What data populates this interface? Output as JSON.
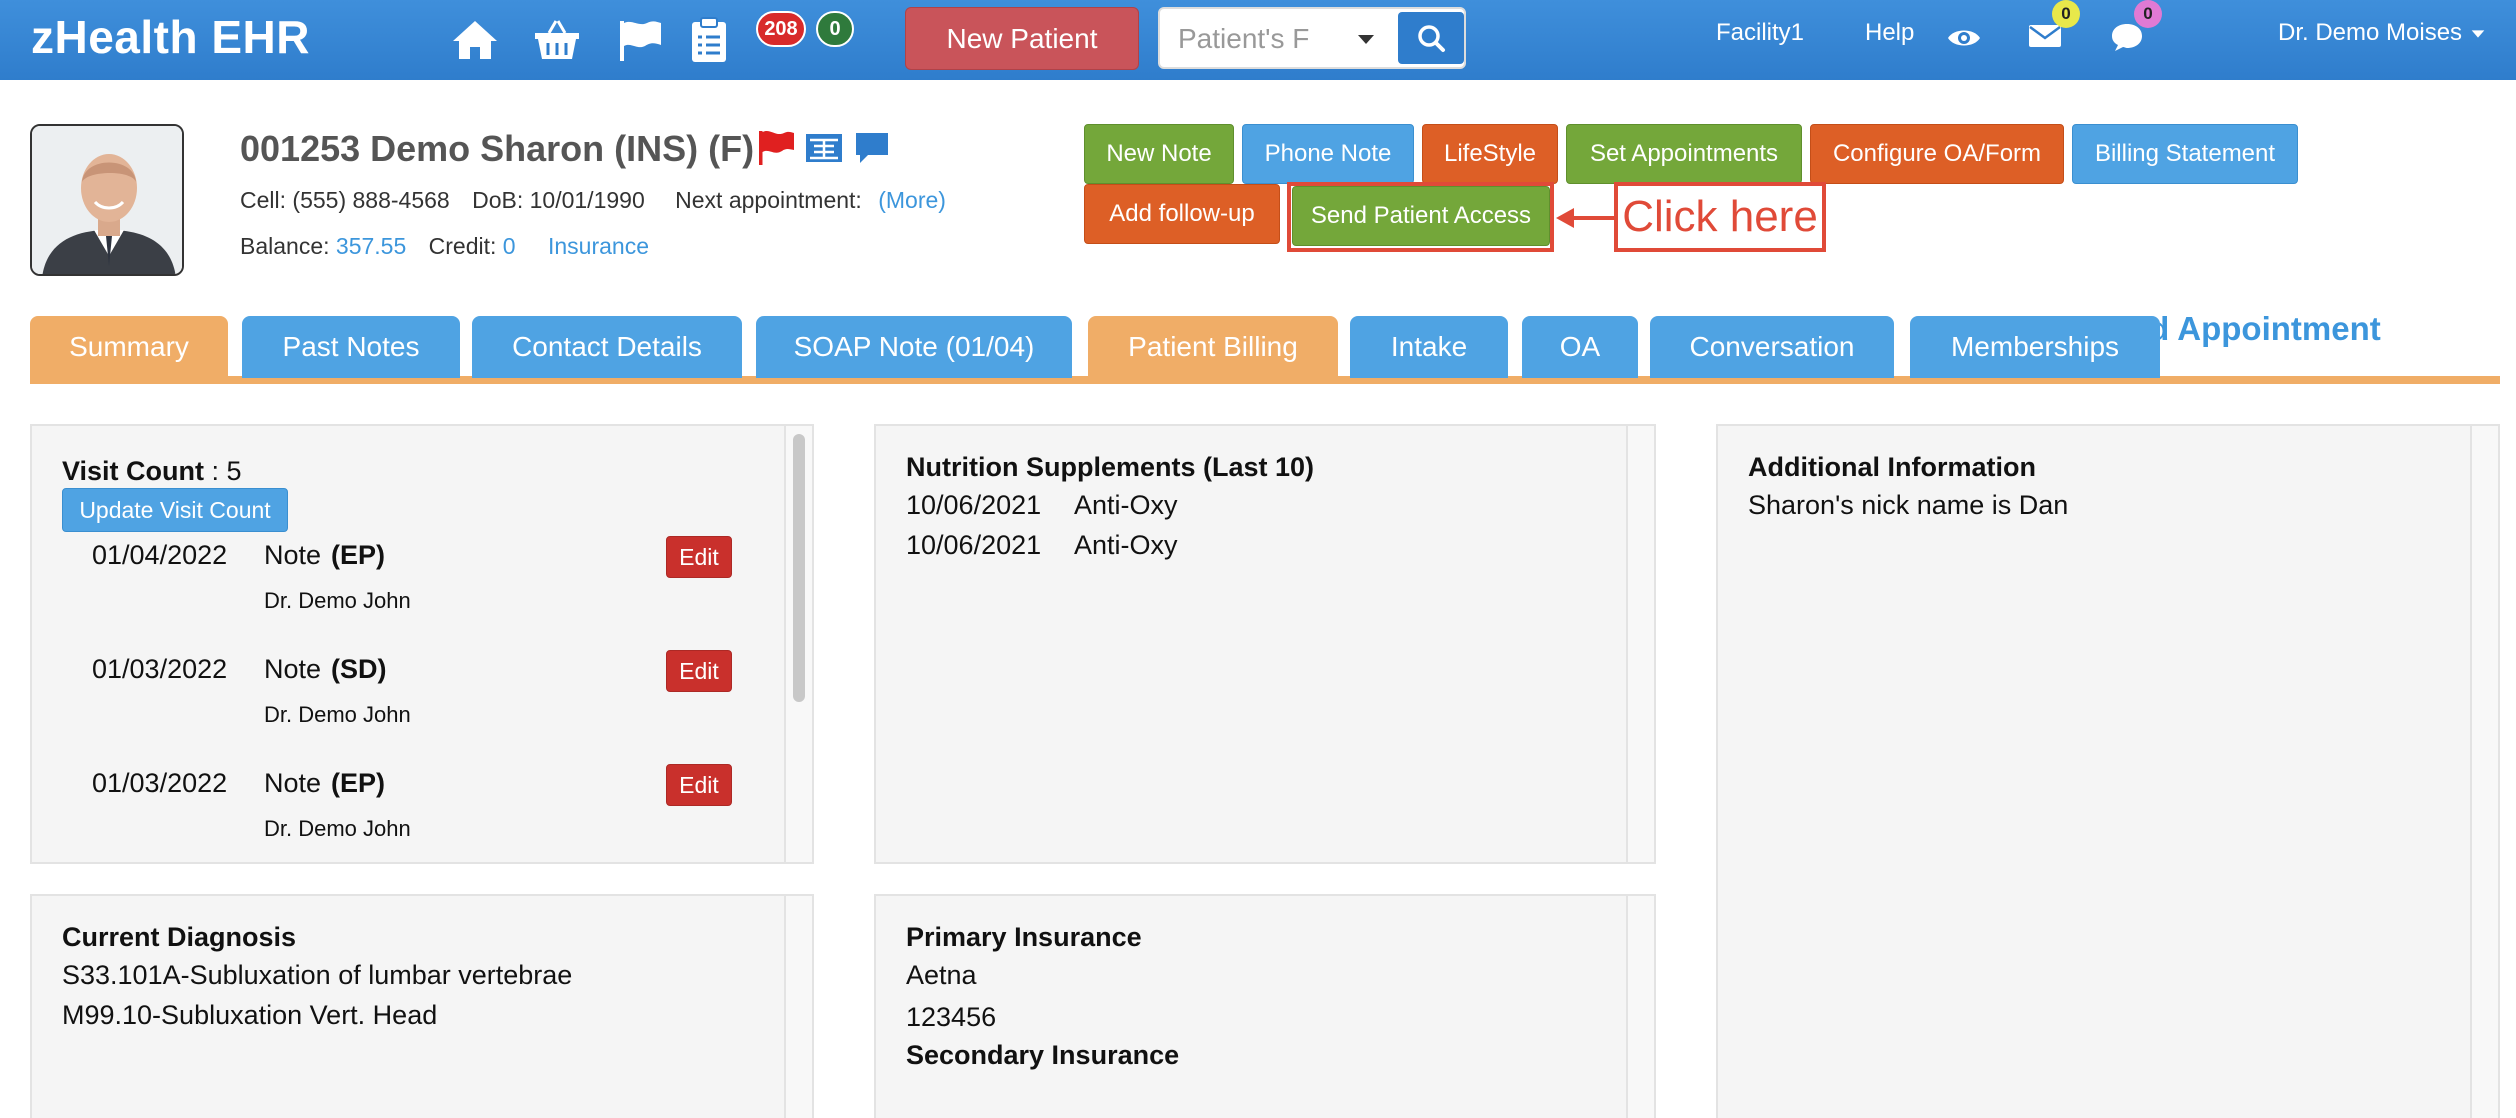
{
  "app": {
    "brand": "zHealth EHR"
  },
  "topbar": {
    "icons": [
      "home-icon",
      "basket-icon",
      "flag-icon",
      "clipboard-icon"
    ],
    "badge_red": "208",
    "badge_green": "0",
    "new_patient": "New Patient",
    "search_placeholder": "Patient's F",
    "facility": "Facility1",
    "help": "Help",
    "mail_count": "0",
    "chat_count": "0",
    "user": "Dr. Demo Moises"
  },
  "patient": {
    "name": "001253 Demo Sharon  (INS) (F)",
    "cell_label": "Cell:",
    "cell": "(555) 888-4568",
    "dob_label": "DoB:",
    "dob": "10/01/1990",
    "next_appt_label": "Next appointment:",
    "more": "(More)",
    "balance_label": "Balance:",
    "balance": "357.55",
    "credit_label": "Credit:",
    "credit": "0",
    "insurance": "Insurance"
  },
  "actions": {
    "new_note": "New Note",
    "phone_note": "Phone Note",
    "lifestyle": "LifeStyle",
    "set_appointments": "Set Appointments",
    "configure_oa": "Configure OA/Form",
    "billing_statement": "Billing Statement",
    "add_followup": "Add follow-up",
    "send_access": "Send Patient Access"
  },
  "callout": "Click here",
  "tabs": {
    "summary": "Summary",
    "past_notes": "Past Notes",
    "contact_details": "Contact Details",
    "soap_note": "SOAP Note (01/04)",
    "patient_billing": "Patient Billing",
    "intake": "Intake",
    "oa": "OA",
    "conversation": "Conversation",
    "memberships": "Memberships"
  },
  "add_appointment": "ld Appointment",
  "visits": {
    "title": "Visit Count",
    "count": " : 5",
    "update_label": "Update Visit Count",
    "edit_label": "Edit",
    "note_word": "Note",
    "items": [
      {
        "date": "01/04/2022",
        "code": "(EP)",
        "doctor": "Dr. Demo John"
      },
      {
        "date": "01/03/2022",
        "code": "(SD)",
        "doctor": "Dr. Demo John"
      },
      {
        "date": "01/03/2022",
        "code": "(EP)",
        "doctor": "Dr. Demo John"
      }
    ]
  },
  "nutrition": {
    "title": "Nutrition Supplements (Last 10)",
    "items": [
      {
        "date": "10/06/2021",
        "name": "Anti-Oxy"
      },
      {
        "date": "10/06/2021",
        "name": "Anti-Oxy"
      }
    ]
  },
  "additional": {
    "title": "Additional Information",
    "text": "Sharon's nick name is Dan"
  },
  "diagnosis": {
    "title": "Current Diagnosis",
    "items": [
      "S33.101A-Subluxation of lumbar vertebrae",
      "M99.10-Subluxation Vert. Head"
    ]
  },
  "insurance": {
    "primary_title": "Primary Insurance",
    "primary_name": "Aetna",
    "primary_id": "123456",
    "secondary_title": "Secondary Insurance"
  },
  "colors": {
    "topbar": "#2f7dcc",
    "green": "#74a73a",
    "blue": "#4fa3e3",
    "orange": "#dd5f26",
    "tab_active": "#f0ad67",
    "annotation": "#e04a38"
  }
}
